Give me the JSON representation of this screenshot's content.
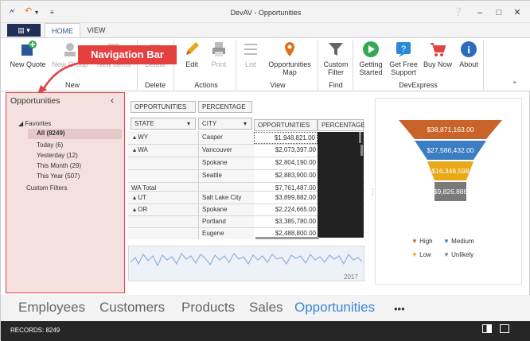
{
  "window": {
    "title": "DevAV - Opportunities"
  },
  "titlebar": {
    "help_icon": "❔",
    "minimize": "–",
    "maximize": "□",
    "close": "✕"
  },
  "tabs": {
    "file_label": "▤ ▾",
    "home": "HOME",
    "view": "VIEW"
  },
  "ribbon": {
    "new_quote": "New Quote",
    "new_group": "New Group",
    "new_items": "New Items",
    "delete": "Delete",
    "edit": "Edit",
    "print": "Print",
    "list": "List",
    "opportunities_map": "Opportunities Map",
    "custom_filter": "Custom Filter",
    "getting_started": "Getting Started",
    "get_free_support": "Get Free Support",
    "buy_now": "Buy Now",
    "about": "About",
    "groups": {
      "new": "New",
      "delete": "Delete",
      "actions": "Actions",
      "view": "View",
      "find": "Find",
      "devexpress": "DevExpress"
    }
  },
  "callout": "Navigation Bar",
  "navpane": {
    "title": "Opportunities",
    "collapse": "‹",
    "favorites": "Favorites",
    "items": [
      "All (8249)",
      "Today (6)",
      "Yesterday (12)",
      "This Month (29)",
      "This Year (507)"
    ],
    "custom_filters": "Custom Filters"
  },
  "pivot": {
    "data_headers": [
      "OPPORTUNITIES",
      "PERCENTAGE"
    ],
    "row_headers": [
      "STATE",
      "CITY"
    ],
    "col_headers": [
      "OPPORTUNITIES",
      "PERCENTAGE"
    ],
    "rows": [
      {
        "state": "▴ WY",
        "city": "Casper",
        "value": "$1,948,821.00"
      },
      {
        "state": "▴ WA",
        "city": "Vancouver",
        "value": "$2,073,397.00"
      },
      {
        "state": "",
        "city": "Spokane",
        "value": "$2,804,190.00"
      },
      {
        "state": "",
        "city": "Seattle",
        "value": "$2,883,900.00"
      },
      {
        "state": "WA Total",
        "city": "",
        "value": "$7,761,487.00"
      },
      {
        "state": "▴ UT",
        "city": "Salt Lake City",
        "value": "$3,899,882.00"
      },
      {
        "state": "▴ OR",
        "city": "Spokane",
        "value": "$2,224,665.00"
      },
      {
        "state": "",
        "city": "Portland",
        "value": "$3,385,780.00"
      },
      {
        "state": "",
        "city": "Eugene",
        "value": "$2,488,800.00"
      }
    ],
    "timeline_year": "2017"
  },
  "chart_data": {
    "type": "funnel",
    "values_labels": [
      "$38,871,163.00",
      "$27,586,432.00",
      "$16,346,598",
      "$9,826,886"
    ],
    "series": [
      {
        "name": "High",
        "color": "#c8632a"
      },
      {
        "name": "Medium",
        "color": "#3a7dc2"
      },
      {
        "name": "Low",
        "color": "#e8a818"
      },
      {
        "name": "Unlikely",
        "color": "#7a7a7a"
      }
    ]
  },
  "modules": [
    "Employees",
    "Customers",
    "Products",
    "Sales",
    "Opportunities",
    "•••"
  ],
  "status": {
    "records": "RECORDS: 8249"
  }
}
